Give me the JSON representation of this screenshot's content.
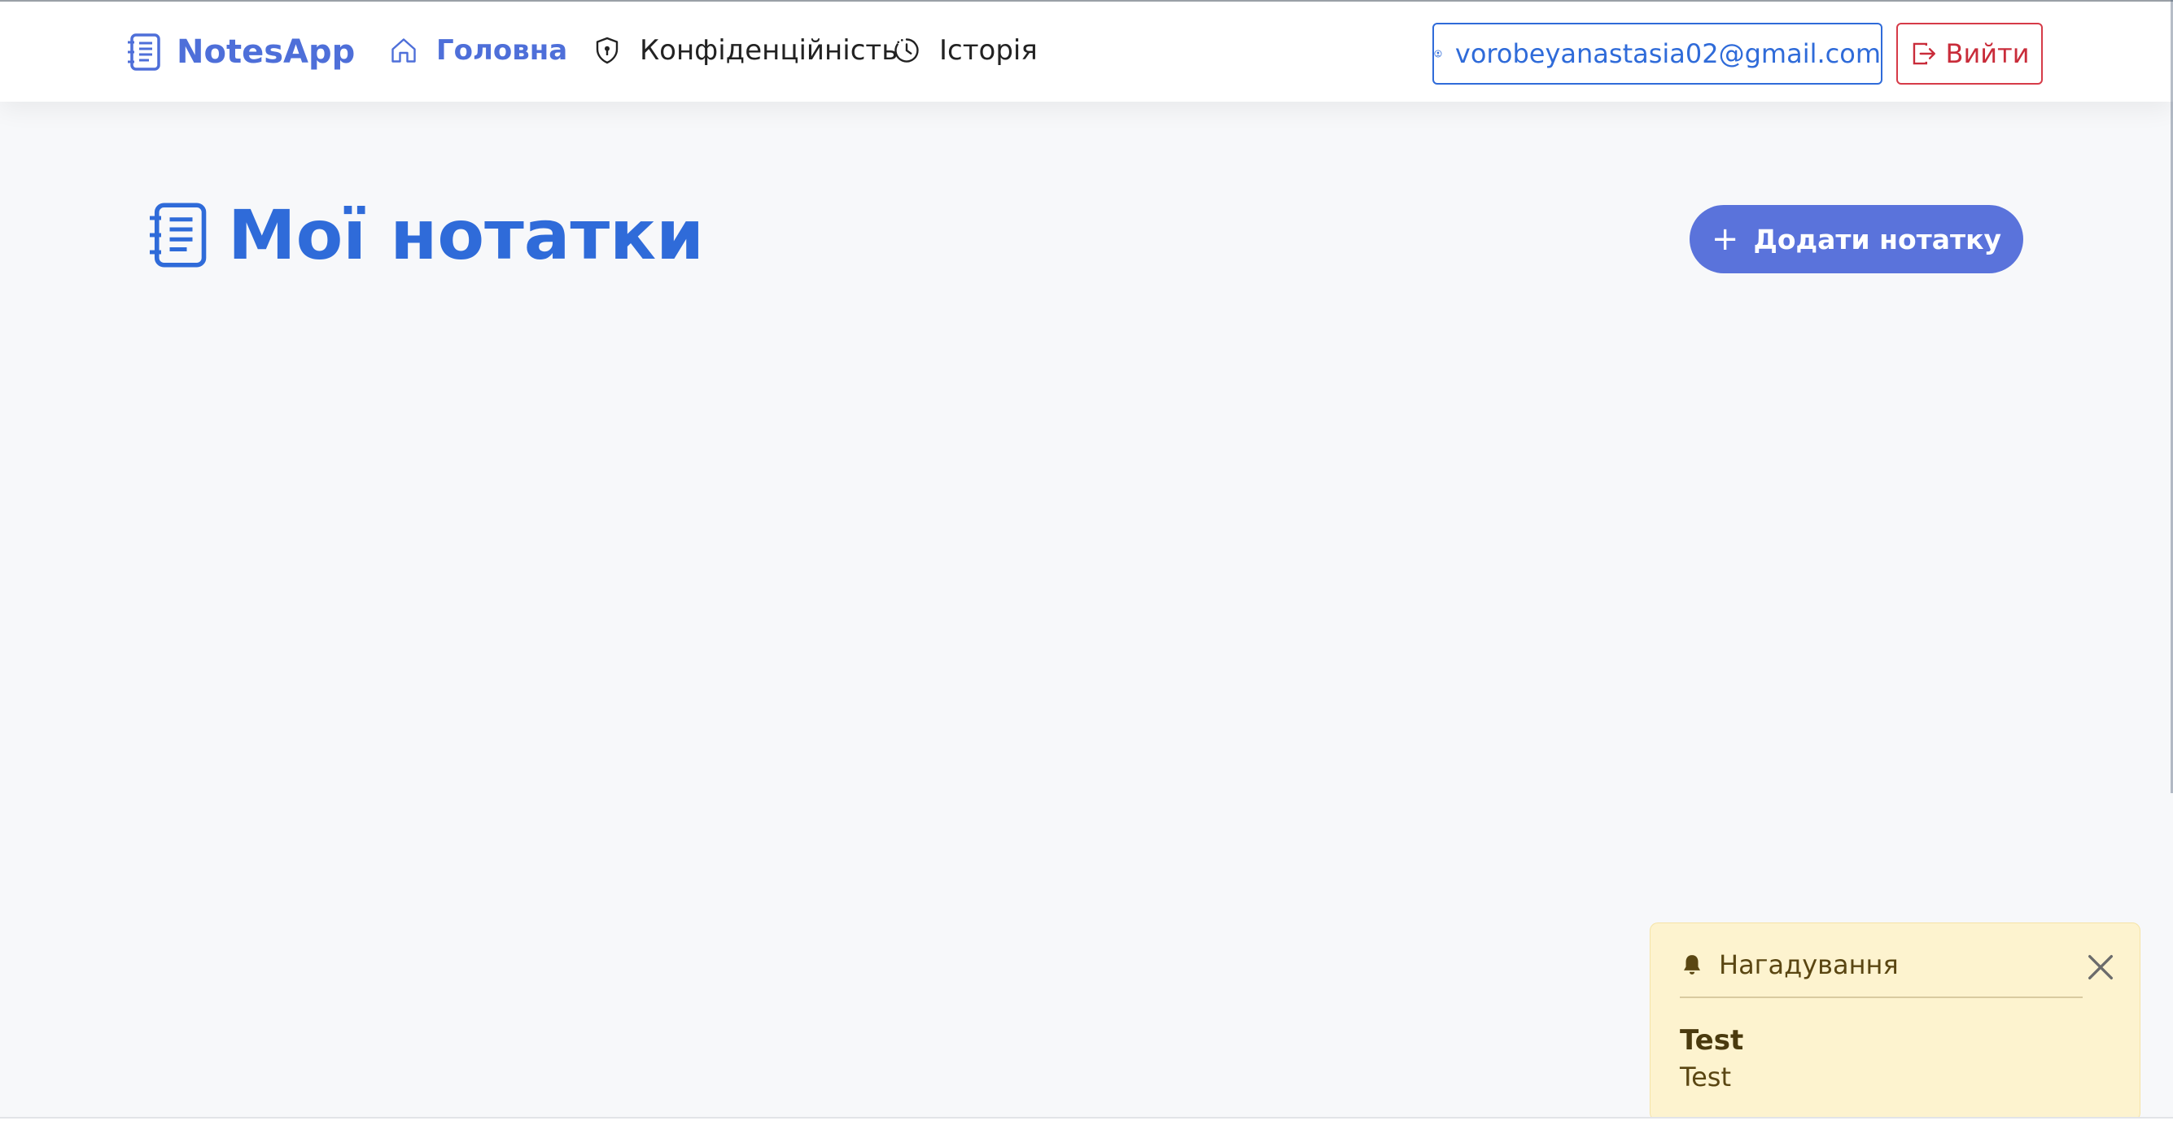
{
  "navbar": {
    "brand": "NotesApp",
    "links": [
      {
        "label": "Головна",
        "icon": "home-icon",
        "active": true
      },
      {
        "label": "Конфіденційність",
        "icon": "shield-icon",
        "active": false
      },
      {
        "label": "Історія",
        "icon": "clock-icon",
        "active": false
      }
    ],
    "user_email": "vorobeyanastasia02@gmail.com",
    "logout_label": "Вийти"
  },
  "main": {
    "title": "Мої нотатки",
    "add_button_label": "Додати нотатку"
  },
  "toast": {
    "header": "Нагадування",
    "title": "Test",
    "body": "Test"
  },
  "colors": {
    "primary": "#2f6bd9",
    "brand": "#4e6fd9",
    "add_button": "#5a73db",
    "danger": "#d63b48",
    "toast_bg": "#fdf3cf",
    "page_bg": "#f7f8fa"
  }
}
